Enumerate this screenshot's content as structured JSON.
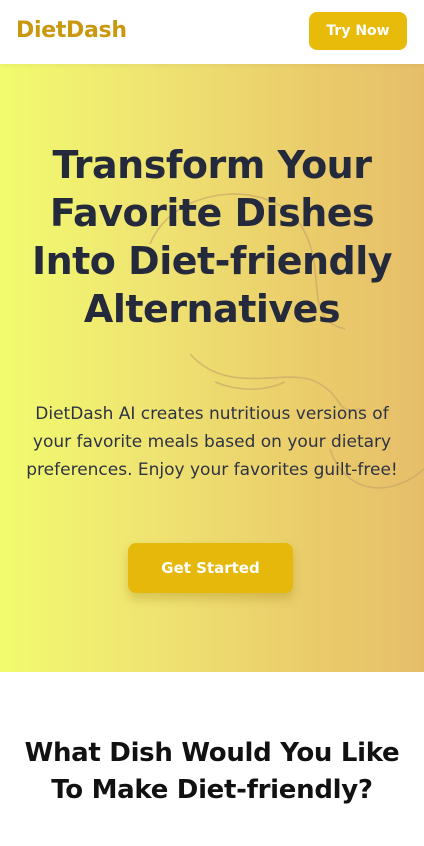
{
  "header": {
    "brand": "DietDash",
    "try_now_label": "Try Now"
  },
  "hero": {
    "title": "Transform Your Favorite Dishes Into Diet-friendly Alternatives",
    "subtitle": "DietDash AI creates nutritious versions of your favorite meals based on your dietary preferences. Enjoy your favorites guilt-free!",
    "cta_label": "Get Started"
  },
  "section": {
    "title": "What Dish Would You Like To Make Diet-friendly?"
  },
  "colors": {
    "brand": "#C9980E",
    "button": "#E8BB0B",
    "hero_gradient_start": "#F2FB6E",
    "hero_gradient_end": "#E6BE6A",
    "heading": "#242A3B"
  }
}
